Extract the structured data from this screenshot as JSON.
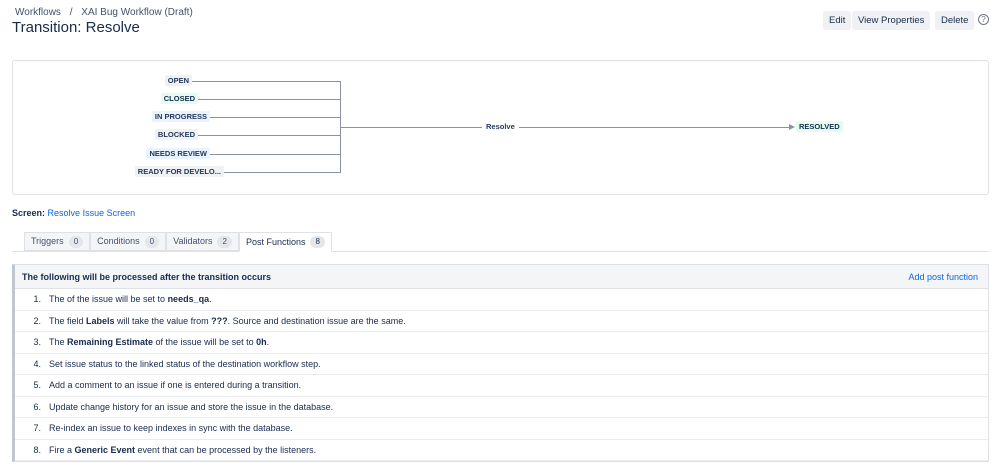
{
  "breadcrumb": [
    "Workflows",
    "XAI Bug Workflow (Draft)"
  ],
  "breadcrumb_sep": "/",
  "title": "Transition: Resolve",
  "buttons": {
    "edit": "Edit",
    "view_properties": "View Properties",
    "delete": "Delete",
    "help": "?"
  },
  "diagram": {
    "from_statuses": [
      {
        "label": "OPEN",
        "style": "grey"
      },
      {
        "label": "CLOSED",
        "style": "green"
      },
      {
        "label": "IN PROGRESS",
        "style": "blue"
      },
      {
        "label": "BLOCKED",
        "style": "grey"
      },
      {
        "label": "NEEDS REVIEW",
        "style": "blue"
      },
      {
        "label": "READY FOR DEVELO...",
        "style": "grey"
      }
    ],
    "transition": "Resolve",
    "to_status": "RESOLVED"
  },
  "screen": {
    "label": "Screen:",
    "value": "Resolve Issue Screen"
  },
  "tabs": [
    {
      "label": "Triggers",
      "count": "0"
    },
    {
      "label": "Conditions",
      "count": "0"
    },
    {
      "label": "Validators",
      "count": "2"
    },
    {
      "label": "Post Functions",
      "count": "8"
    }
  ],
  "panel": {
    "header": "The following will be processed after the transition occurs",
    "add": "Add post function",
    "items": [
      [
        {
          "t": "The of the issue will be set to "
        },
        {
          "b": "needs_qa"
        },
        {
          "t": "."
        }
      ],
      [
        {
          "t": "The field "
        },
        {
          "b": "Labels"
        },
        {
          "t": " will take the value from "
        },
        {
          "b": "???"
        },
        {
          "t": ". Source and destination issue are the same."
        }
      ],
      [
        {
          "t": "The "
        },
        {
          "b": "Remaining Estimate"
        },
        {
          "t": " of the issue will be set to "
        },
        {
          "b": "0h"
        },
        {
          "t": "."
        }
      ],
      [
        {
          "t": "Set issue status to the linked status of the destination workflow step."
        }
      ],
      [
        {
          "t": "Add a comment to an issue if one is entered during a transition."
        }
      ],
      [
        {
          "t": "Update change history for an issue and store the issue in the database."
        }
      ],
      [
        {
          "t": "Re-index an issue to keep indexes in sync with the database."
        }
      ],
      [
        {
          "t": "Fire a "
        },
        {
          "b": "Generic Event"
        },
        {
          "t": " event that can be processed by the listeners."
        }
      ]
    ]
  }
}
